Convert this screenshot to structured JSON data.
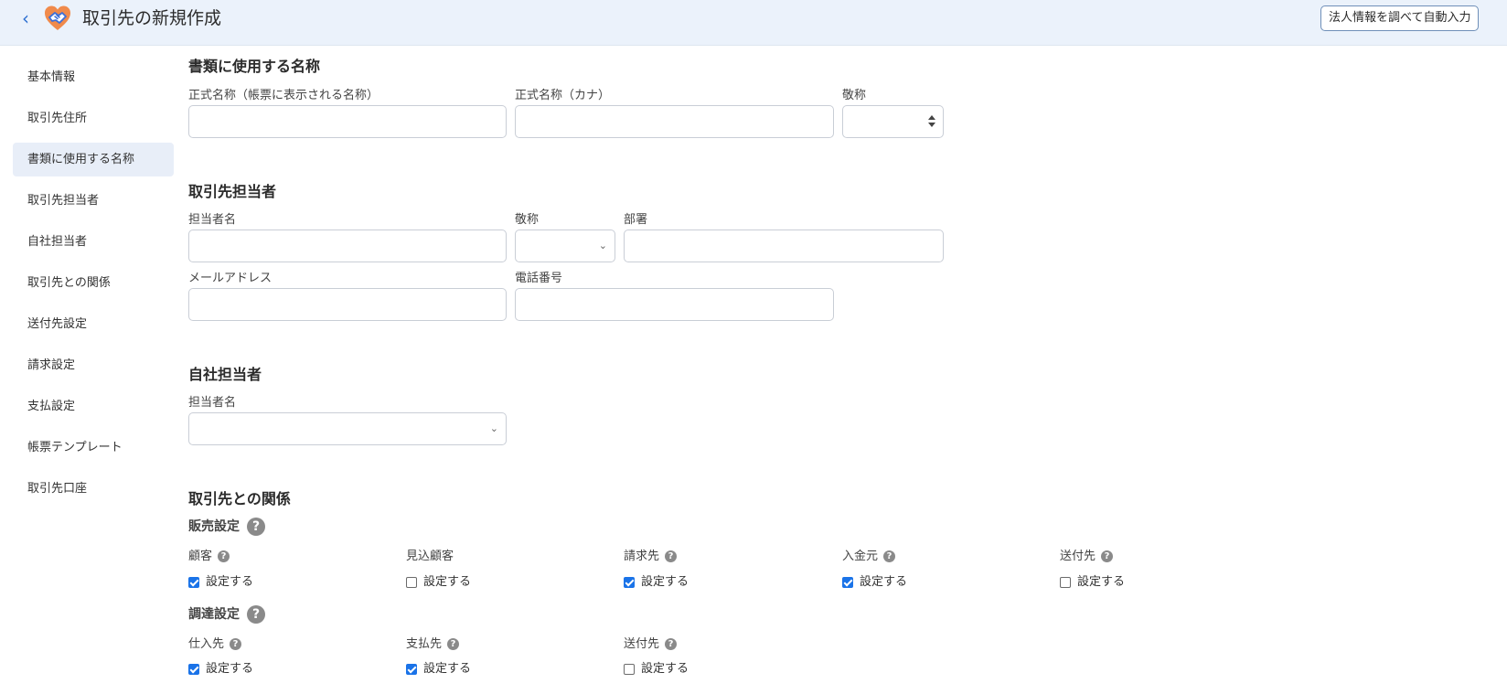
{
  "header": {
    "back_icon": "‹",
    "title": "取引先の新規作成",
    "auto_fill_button": "法人情報を調べて自動入力"
  },
  "sidebar": {
    "items": [
      {
        "label": "基本情報",
        "active": false
      },
      {
        "label": "取引先住所",
        "active": false
      },
      {
        "label": "書類に使用する名称",
        "active": true
      },
      {
        "label": "取引先担当者",
        "active": false
      },
      {
        "label": "自社担当者",
        "active": false
      },
      {
        "label": "取引先との関係",
        "active": false
      },
      {
        "label": "送付先設定",
        "active": false
      },
      {
        "label": "請求設定",
        "active": false
      },
      {
        "label": "支払設定",
        "active": false
      },
      {
        "label": "帳票テンプレート",
        "active": false
      },
      {
        "label": "取引先口座",
        "active": false
      }
    ]
  },
  "doc_names": {
    "title": "書類に使用する名称",
    "official_name_label": "正式名称（帳票に表示される名称）",
    "official_name_value": "",
    "official_kana_label": "正式名称（カナ）",
    "official_kana_value": "",
    "honorific_label": "敬称",
    "honorific_value": ""
  },
  "client_contact": {
    "title": "取引先担当者",
    "name_label": "担当者名",
    "name_value": "",
    "honorific_label": "敬称",
    "honorific_value": "",
    "department_label": "部署",
    "department_value": "",
    "email_label": "メールアドレス",
    "email_value": "",
    "phone_label": "電話番号",
    "phone_value": ""
  },
  "own_contact": {
    "title": "自社担当者",
    "name_label": "担当者名",
    "name_value": ""
  },
  "relations": {
    "title": "取引先との関係",
    "sales": {
      "title": "販売設定",
      "items": [
        {
          "label": "顧客",
          "help": true,
          "checkbox_label": "設定する",
          "checked": true
        },
        {
          "label": "見込顧客",
          "help": false,
          "checkbox_label": "設定する",
          "checked": false
        },
        {
          "label": "請求先",
          "help": true,
          "checkbox_label": "設定する",
          "checked": true
        },
        {
          "label": "入金元",
          "help": true,
          "checkbox_label": "設定する",
          "checked": true
        },
        {
          "label": "送付先",
          "help": true,
          "checkbox_label": "設定する",
          "checked": false
        }
      ]
    },
    "procurement": {
      "title": "調達設定",
      "items": [
        {
          "label": "仕入先",
          "help": true,
          "checkbox_label": "設定する",
          "checked": true
        },
        {
          "label": "支払先",
          "help": true,
          "checkbox_label": "設定する",
          "checked": true
        },
        {
          "label": "送付先",
          "help": true,
          "checkbox_label": "設定する",
          "checked": false
        }
      ]
    }
  },
  "icons": {
    "help_glyph": "?",
    "chevron_glyph": "⌄"
  },
  "colors": {
    "header_bg": "#ebf2fb",
    "accent": "#1a73e8",
    "sidebar_active_bg": "#e8eef8",
    "logo_orange": "#f08a4b",
    "logo_blue": "#3c6fd8"
  }
}
